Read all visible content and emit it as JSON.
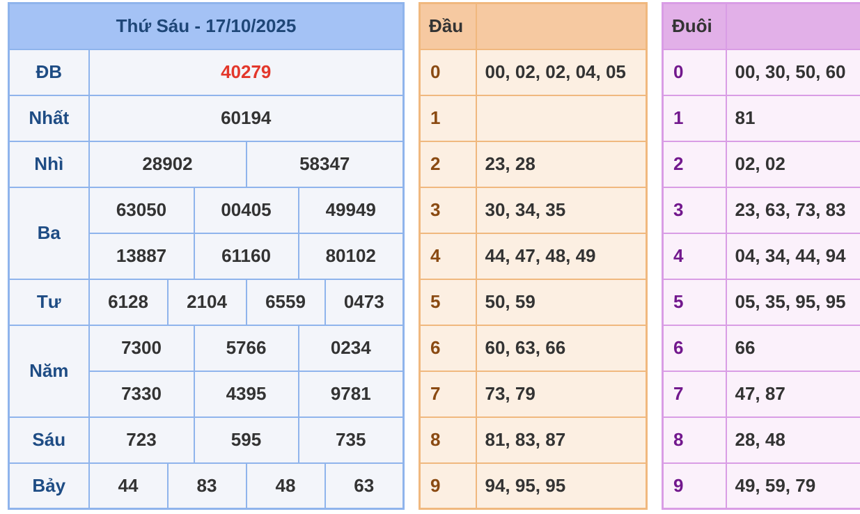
{
  "results": {
    "title": "Thứ Sáu - 17/10/2025",
    "prizes": {
      "db": {
        "label": "ĐB",
        "values": [
          "40279"
        ]
      },
      "nhat": {
        "label": "Nhất",
        "values": [
          "60194"
        ]
      },
      "nhi": {
        "label": "Nhì",
        "values": [
          "28902",
          "58347"
        ]
      },
      "ba": {
        "label": "Ba",
        "values": [
          "63050",
          "00405",
          "49949",
          "13887",
          "61160",
          "80102"
        ]
      },
      "tu": {
        "label": "Tư",
        "values": [
          "6128",
          "2104",
          "6559",
          "0473"
        ]
      },
      "nam": {
        "label": "Năm",
        "values": [
          "7300",
          "5766",
          "0234",
          "7330",
          "4395",
          "9781"
        ]
      },
      "sau": {
        "label": "Sáu",
        "values": [
          "723",
          "595",
          "735"
        ]
      },
      "bay": {
        "label": "Bảy",
        "values": [
          "44",
          "83",
          "48",
          "63"
        ]
      }
    }
  },
  "dau": {
    "header": "Đầu",
    "rows": [
      {
        "key": "0",
        "values": "00, 02, 02, 04, 05"
      },
      {
        "key": "1",
        "values": ""
      },
      {
        "key": "2",
        "values": "23, 28"
      },
      {
        "key": "3",
        "values": "30, 34, 35"
      },
      {
        "key": "4",
        "values": "44, 47, 48, 49"
      },
      {
        "key": "5",
        "values": "50, 59"
      },
      {
        "key": "6",
        "values": "60, 63, 66"
      },
      {
        "key": "7",
        "values": "73, 79"
      },
      {
        "key": "8",
        "values": "81, 83, 87"
      },
      {
        "key": "9",
        "values": "94, 95, 95"
      }
    ]
  },
  "duoi": {
    "header": "Đuôi",
    "rows": [
      {
        "key": "0",
        "values": "00, 30, 50, 60"
      },
      {
        "key": "1",
        "values": "81"
      },
      {
        "key": "2",
        "values": "02, 02"
      },
      {
        "key": "3",
        "values": "23, 63, 73, 83"
      },
      {
        "key": "4",
        "values": "04, 34, 44, 94"
      },
      {
        "key": "5",
        "values": "05, 35, 95, 95"
      },
      {
        "key": "6",
        "values": "66"
      },
      {
        "key": "7",
        "values": "47, 87"
      },
      {
        "key": "8",
        "values": "28, 48"
      },
      {
        "key": "9",
        "values": "49, 59, 79"
      }
    ]
  },
  "colors": {
    "blue_border": "#8fb4ec",
    "blue_header": "#a4c2f5",
    "special_red": "#e3372b",
    "orange_border": "#f0b87e",
    "purple_border": "#d99de5"
  }
}
